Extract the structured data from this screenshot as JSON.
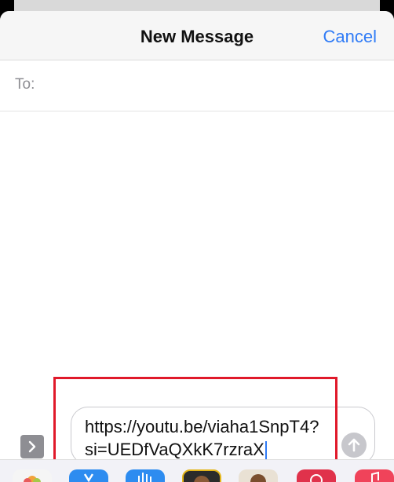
{
  "nav": {
    "title": "New Message",
    "cancel_label": "Cancel"
  },
  "recipient": {
    "label": "To:",
    "value": ""
  },
  "composer": {
    "line1": "https://youtu.be/viaha1SnpT4?",
    "line2": "si=UEDfVaQXkK7rzraX"
  },
  "colors": {
    "accent": "#2f7bf6",
    "highlight_box": "#e0192a"
  },
  "app_strip": {
    "icons": [
      "photos-app-icon",
      "app-store-icon",
      "audio-messages-icon",
      "memoji-icon",
      "memoji-stickers-icon",
      "digital-touch-icon",
      "music-app-icon"
    ]
  }
}
